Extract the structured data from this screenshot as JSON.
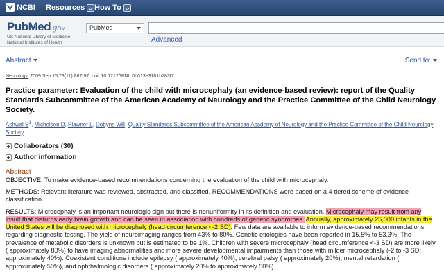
{
  "topbar": {
    "brand": "NCBI",
    "menus": [
      {
        "label": "Resources"
      },
      {
        "label": "How To"
      }
    ]
  },
  "header": {
    "logo_word": "PubMed",
    "logo_gov": ".gov",
    "logo_sub1": "US National Library of Medicine",
    "logo_sub2": "National Institutes of Health",
    "database": "PubMed",
    "search_value": "",
    "advanced": "Advanced"
  },
  "toolbar": {
    "format": "Abstract",
    "send_to": "Send to:"
  },
  "article": {
    "journal": "Neurology.",
    "citation_rest": " 2009 Sep 15;73(11):887-97. doi: 10.1212/WNL.0b013e3181b783f7.",
    "title": "Practice parameter: Evaluation of the child with microcephaly (an evidence-based review): report of the Quality Standards Subcommittee of the American Academy of Neurology and the Practice Committee of the Child Neurology Society.",
    "authors": [
      {
        "name": "Ashwal S",
        "sup": "1"
      },
      {
        "name": "Michelson D"
      },
      {
        "name": "Plawner L"
      },
      {
        "name": "Dobyns WB"
      },
      {
        "name": "Quality Standards Subcommittee of the American Academy of Neurology and the Practice Committee of the Child Neurology Society"
      }
    ],
    "collaborators": "Collaborators (30)",
    "author_info": "Author information"
  },
  "abstract": {
    "heading": "Abstract",
    "objective_label": "OBJECTIVE:",
    "objective": " To make evidence-based recommendations concerning the evaluation of the child with microcephaly.",
    "methods_label": "METHODS:",
    "methods": " Relevant literature was reviewed, abstracted, and classified. RECOMMENDATIONS were based on a 4-tiered scheme of evidence classification.",
    "results_label": "RESULTS:",
    "results_1": " Microcephaly is an important neurologic sign but there is nonuniformity in its definition and evaluation. ",
    "results_pink": "Microcephaly may result from any insult that disturbs early brain growth and can be seen in association with hundreds of genetic syndromes.",
    "results_gap": " ",
    "results_yellow": "Annually, approximately 25,000 infants in the United States will be diagnosed with microcephaly (head circumference <-2 SD).",
    "results_2": " Few data are available to inform evidence-based recommendations regarding diagnostic testing. The yield of neuroimaging ranges from 43% to 80%. Genetic etiologies have been reported in 15.5% to 53.3%. The prevalence of metabolic disorders is unknown but is estimated to be 1%. Children with severe microcephaly (head circumference <-3 SD) are more likely ( approximately 80%) to have imaging abnormalities and more severe developmental impairments than those with milder microcephaly (-2 to -3 SD; approximately 40%). Coexistent conditions include epilepsy ( approximately 40%), cerebral palsy ( approximately 20%), mental retardation ( approximately 50%), and ophthalmologic disorders ( approximately 20% to approximately 50%).",
    "highlight_colors": {
      "pink": "#f3a2b6",
      "yellow": "#f7ef3b"
    }
  }
}
